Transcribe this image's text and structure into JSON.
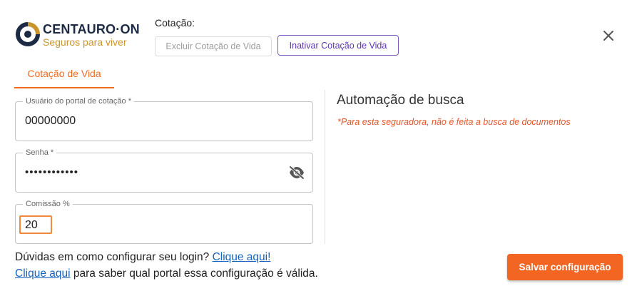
{
  "brand": {
    "name": "CENTAURO·ON",
    "tagline": "Seguros para viver",
    "colors": {
      "navy": "#1d2a44",
      "gold": "#c9952b"
    }
  },
  "header": {
    "cotacao_label": "Cotação:",
    "excluir_label": "Excluir Cotação de Vida",
    "inativar_label": "Inativar Cotação de Vida",
    "close_icon": "close-icon"
  },
  "tabs": [
    {
      "label": "Cotação de Vida",
      "active": true
    }
  ],
  "form": {
    "usuario": {
      "label": "Usuário do portal de cotação *",
      "value": "00000000"
    },
    "senha": {
      "label": "Senha *",
      "value": "••••••••••••",
      "icon": "eye-off-icon"
    },
    "comissao": {
      "label": "Comissão %",
      "value": "20"
    }
  },
  "automacao": {
    "title": "Automação de busca",
    "note": "*Para esta seguradora, não é feita a busca de documentos"
  },
  "help": {
    "line1_text": "Dúvidas em como configurar seu login? ",
    "line1_link": "Clique aqui!",
    "line2_link": "Clique aqui",
    "line2_text": " para saber qual portal essa configuração é válida."
  },
  "actions": {
    "save_label": "Salvar configuração"
  },
  "colors": {
    "accent": "#f26522",
    "purple": "#5e35b1",
    "link": "#1565c0",
    "note": "#e0552a"
  }
}
